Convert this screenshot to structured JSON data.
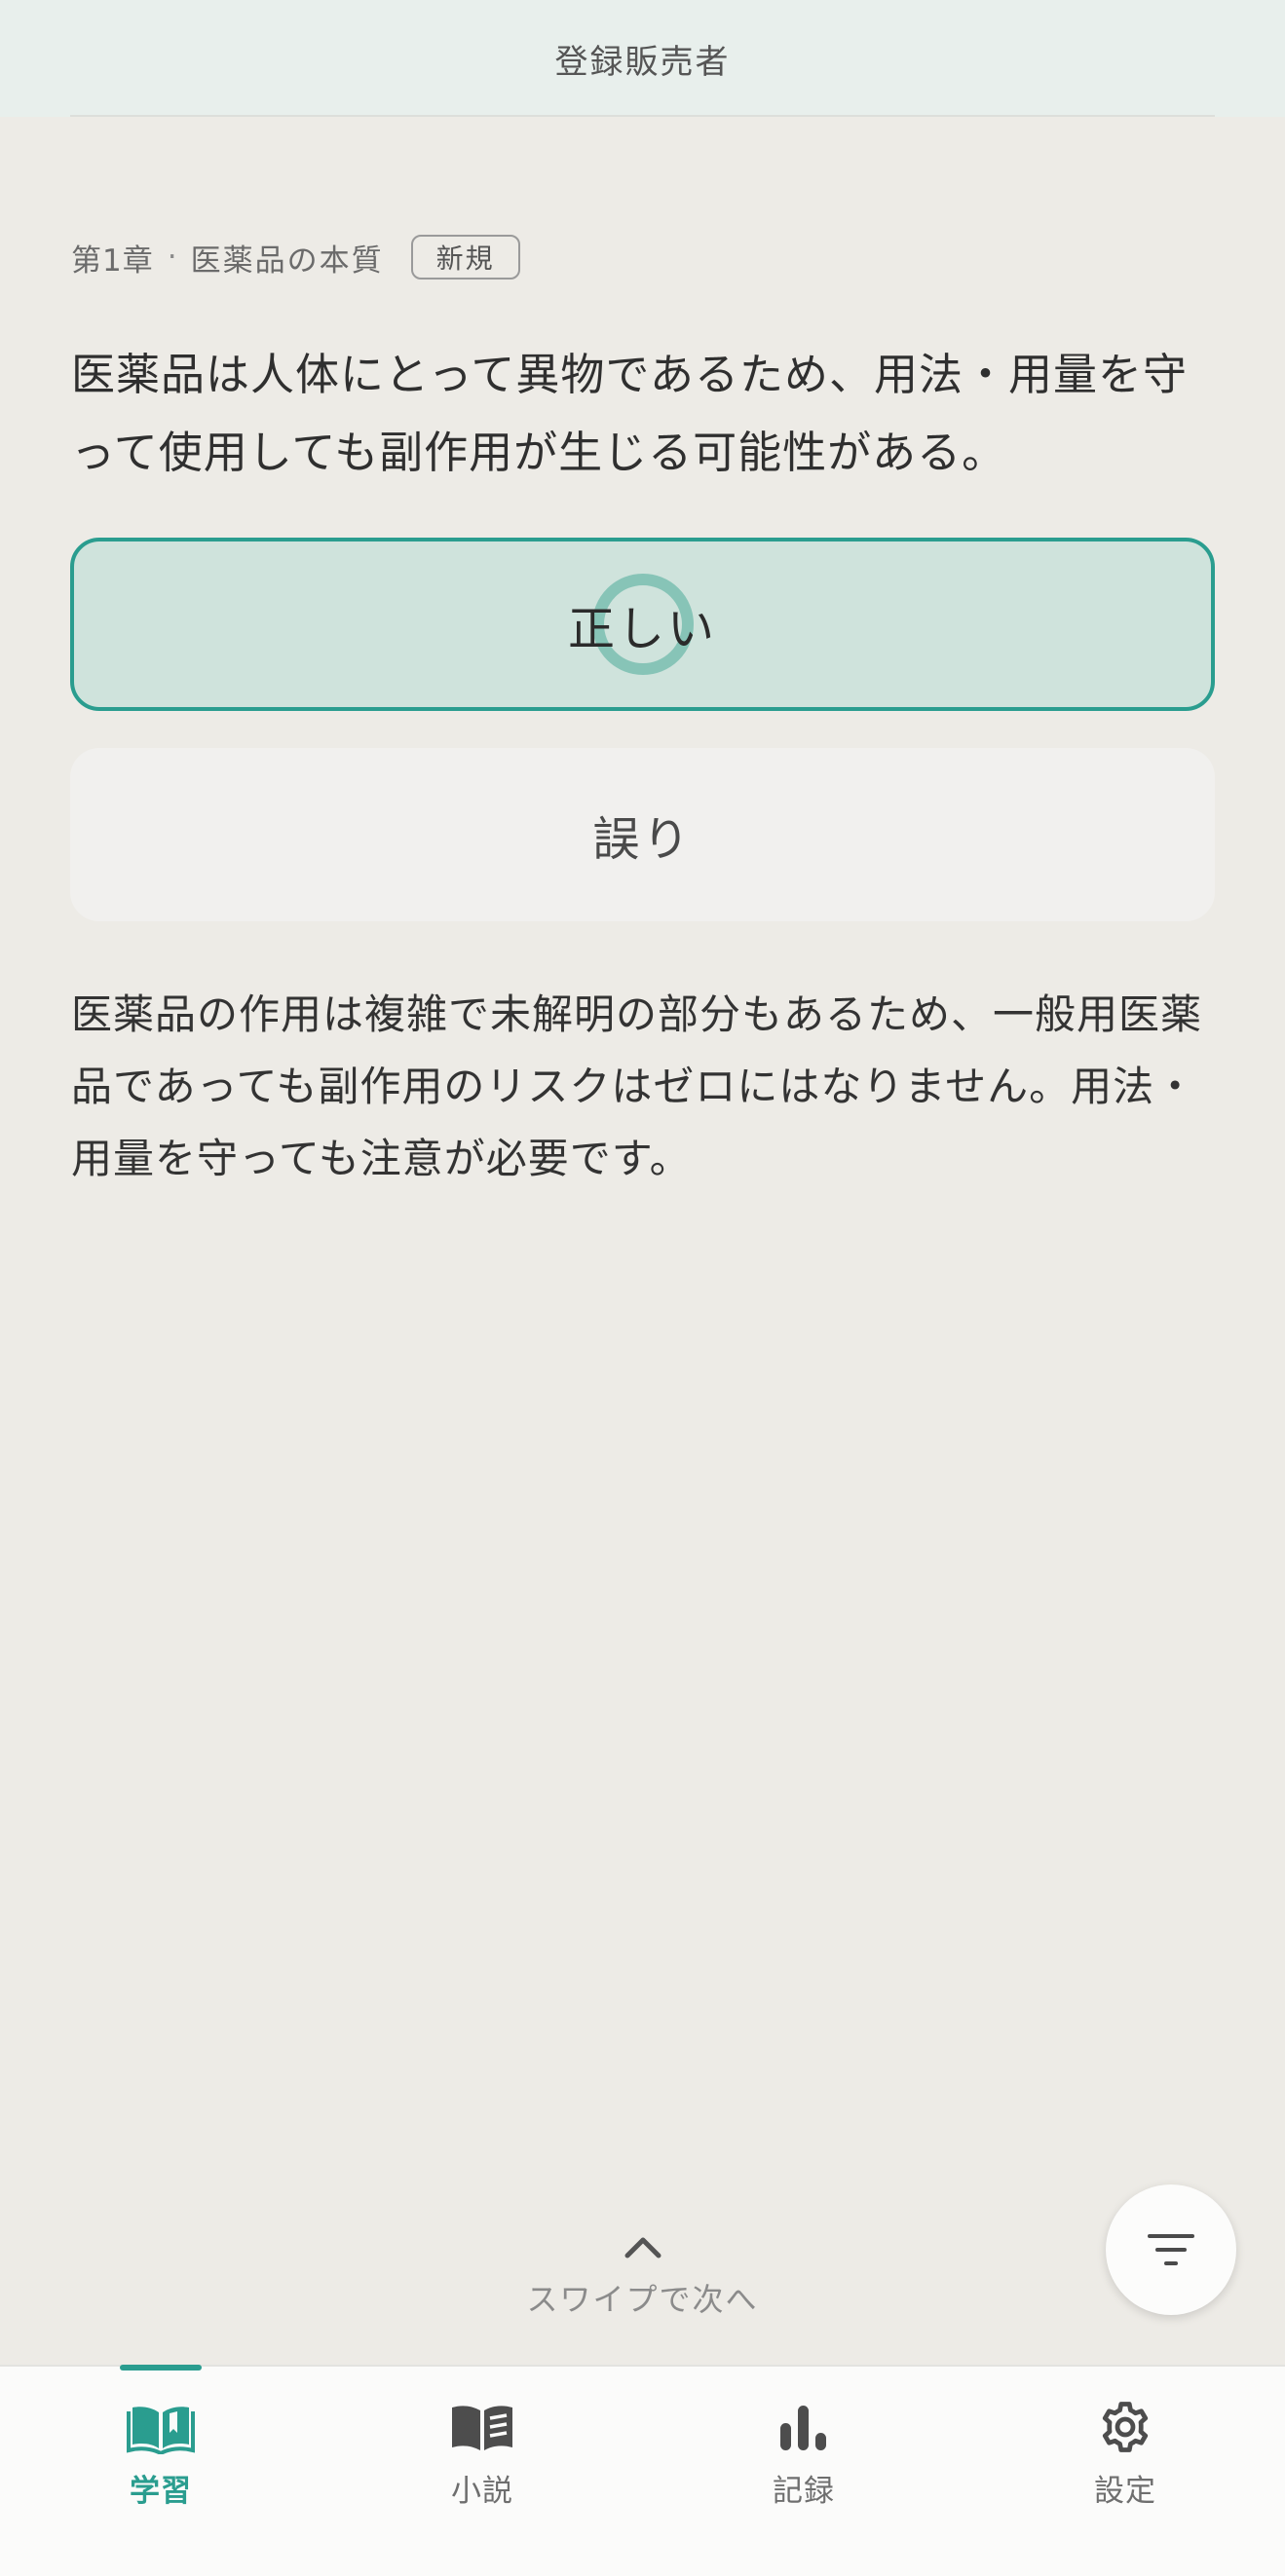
{
  "header": {
    "title": "登録販売者"
  },
  "card": {
    "chapter": "第1章",
    "separator": "·",
    "section": "医薬品の本質",
    "badge": "新規",
    "question": "医薬品は人体にとって異物であるため、用法・用量を守って使用しても副作用が生じる可能性がある。",
    "answers": {
      "true_label": "正しい",
      "false_label": "誤り"
    },
    "explanation": "医薬品の作用は複雑で未解明の部分もあるため、一般用医薬品であっても副作用のリスクはゼロにはなりません。用法・用量を守っても注意が必要です。"
  },
  "swipe_hint": {
    "label": "スワイプで次へ",
    "icon": "chevron-up-icon"
  },
  "fab": {
    "icon": "filter-icon"
  },
  "nav": {
    "active_color": "#2a9d8f",
    "items": [
      {
        "label": "学習",
        "icon": "book-open-icon",
        "active": true
      },
      {
        "label": "小説",
        "icon": "novel-icon",
        "active": false
      },
      {
        "label": "記録",
        "icon": "bar-chart-icon",
        "active": false
      },
      {
        "label": "設定",
        "icon": "gear-icon",
        "active": false
      }
    ]
  }
}
